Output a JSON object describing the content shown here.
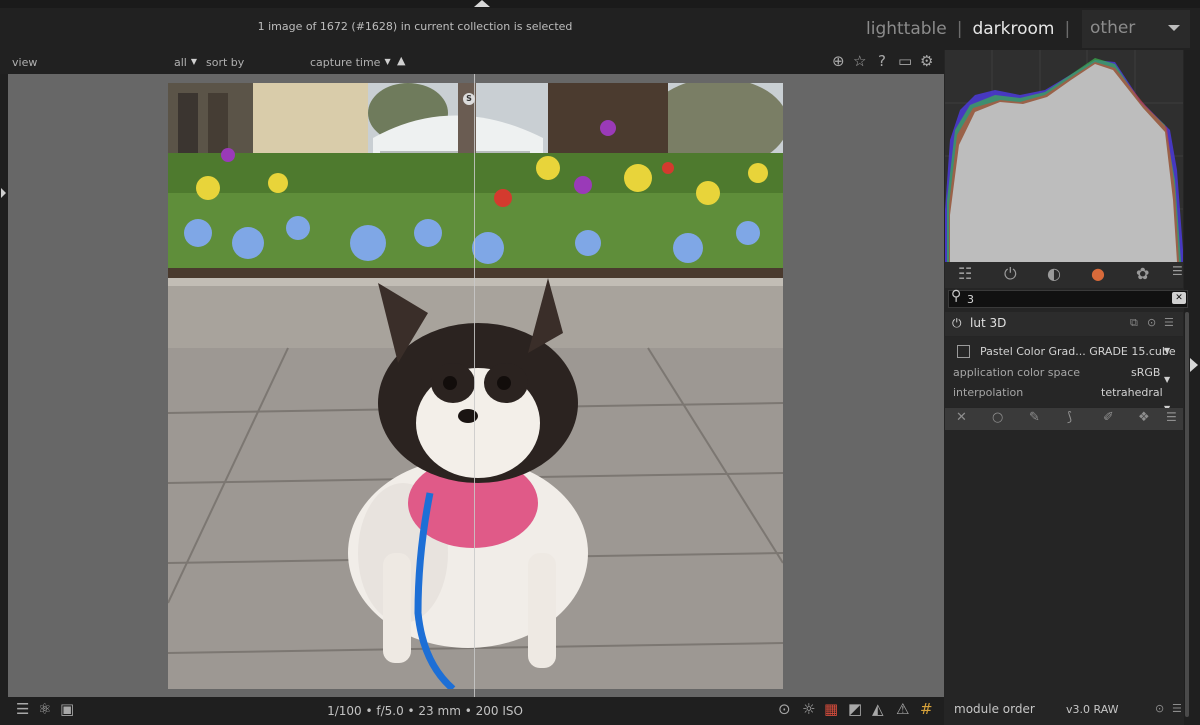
{
  "header": {
    "status": "1 image of 1672 (#1628) in current collection is selected",
    "views": [
      "lighttable",
      "darkroom",
      "other"
    ],
    "active_view": "darkroom"
  },
  "filterbar": {
    "view_label": "view",
    "filter_value": "all",
    "sort_label": "sort by",
    "sort_value": "capture time",
    "sort_direction": "▲"
  },
  "toolbar_icons": [
    "grouping-icon",
    "star-icon",
    "help-icon",
    "keyboard-icon",
    "gear-icon"
  ],
  "split_marker": "S",
  "bottombar": {
    "exif": "1/100 • f/5.0 • 23 mm • 200 ISO"
  },
  "right_panel": {
    "search_value": "3",
    "module": {
      "title": "lut 3D",
      "lut_file": "Pastel Color Grad... GRADE 15.cube",
      "rows": [
        {
          "label": "application color space",
          "value": "sRGB"
        },
        {
          "label": "interpolation",
          "value": "tetrahedral"
        }
      ]
    },
    "module_order_label": "module order",
    "module_order_value": "v3.0 RAW"
  },
  "colors": {
    "background": "#1f1f1f",
    "center_bg": "#676767",
    "panel_bg": "#252525",
    "text": "#b8b8b8",
    "active_text": "#e6e6e6"
  }
}
